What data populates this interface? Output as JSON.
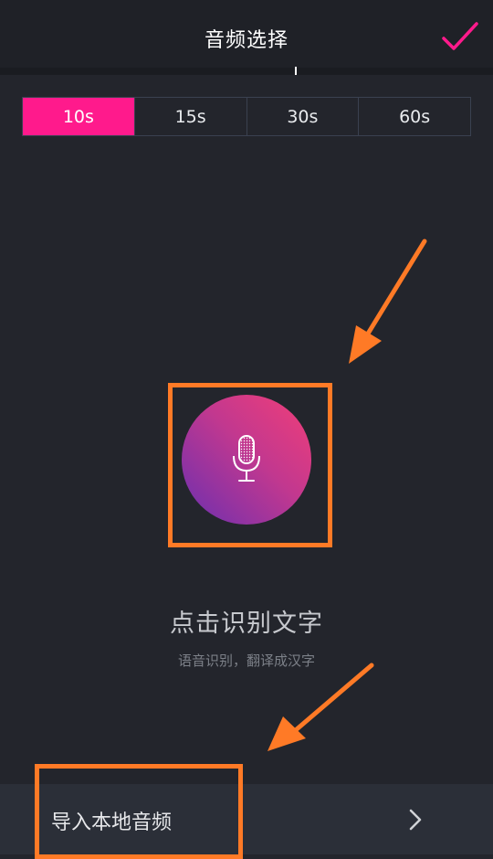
{
  "header": {
    "title": "音频选择",
    "confirm_icon": "checkmark-icon",
    "accent_color": "#ff1a8c"
  },
  "durations": {
    "options": [
      "10s",
      "15s",
      "30s",
      "60s"
    ],
    "selected": "10s"
  },
  "recognition": {
    "mic_icon": "microphone-icon",
    "hint": "点击识别文字",
    "subhint": "语音识别，翻译成汉字"
  },
  "import_bar": {
    "label": "导入本地音频",
    "chevron_icon": "chevron-right-icon"
  },
  "annotations": {
    "highlight_color": "#ff7a26"
  }
}
